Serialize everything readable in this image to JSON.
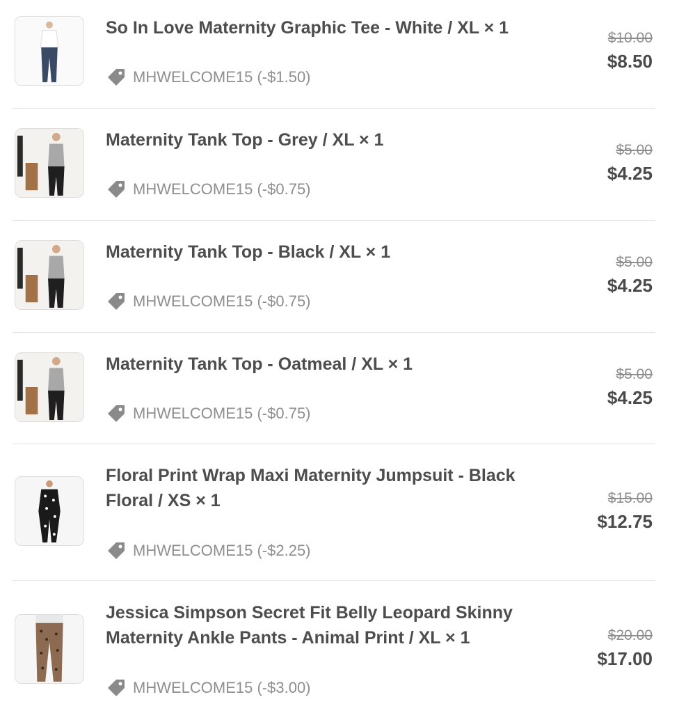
{
  "items": [
    {
      "title": "So In Love Maternity Graphic Tee - White / XL × 1",
      "discount_code": "MHWELCOME15 (-$1.50)",
      "original_price": "$10.00",
      "price": "$8.50",
      "thumbnail": "white-graphic-tee-photo"
    },
    {
      "title": "Maternity Tank Top - Grey / XL × 1",
      "discount_code": "MHWELCOME15 (-$0.75)",
      "original_price": "$5.00",
      "price": "$4.25",
      "thumbnail": "grey-tank-top-photo"
    },
    {
      "title": "Maternity Tank Top - Black / XL × 1",
      "discount_code": "MHWELCOME15 (-$0.75)",
      "original_price": "$5.00",
      "price": "$4.25",
      "thumbnail": "black-tank-top-photo"
    },
    {
      "title": "Maternity Tank Top - Oatmeal / XL × 1",
      "discount_code": "MHWELCOME15 (-$0.75)",
      "original_price": "$5.00",
      "price": "$4.25",
      "thumbnail": "oatmeal-tank-top-photo"
    },
    {
      "title": "Floral Print Wrap Maxi Maternity Jumpsuit - Black Floral / XS × 1",
      "discount_code": "MHWELCOME15 (-$2.25)",
      "original_price": "$15.00",
      "price": "$12.75",
      "thumbnail": "floral-jumpsuit-photo"
    },
    {
      "title": "Jessica Simpson Secret Fit Belly Leopard Skinny Maternity Ankle Pants - Animal Print / XL × 1",
      "discount_code": "MHWELCOME15 (-$3.00)",
      "original_price": "$20.00",
      "price": "$17.00",
      "thumbnail": "leopard-pants-photo"
    }
  ],
  "icons": {
    "discount": "tag-icon"
  },
  "colors": {
    "text_primary": "#4a4a4a",
    "text_muted": "#8e8e8e",
    "divider": "#e3e3e3"
  }
}
